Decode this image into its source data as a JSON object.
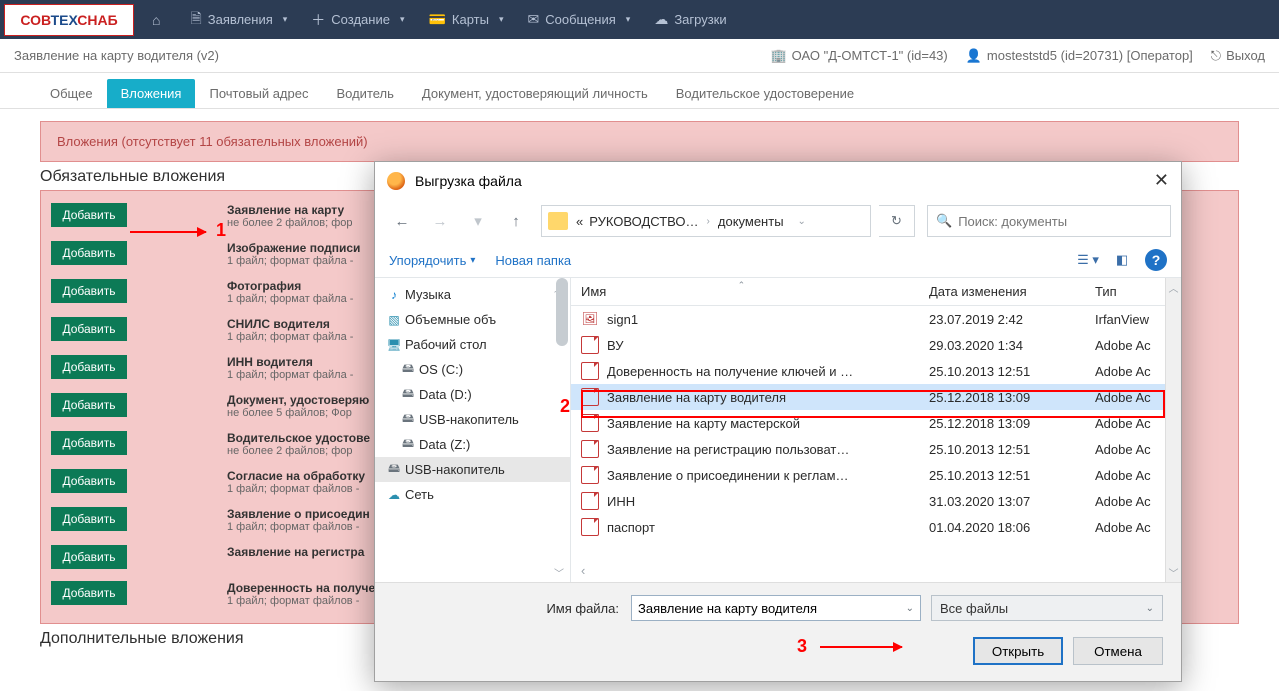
{
  "topnav": {
    "logo_html": "СОВТЕХСНАБ",
    "items": [
      {
        "icon": "⌂",
        "label": ""
      },
      {
        "icon": "📄",
        "label": "Заявления"
      },
      {
        "icon": "+",
        "label": "Создание"
      },
      {
        "icon": "💳",
        "label": "Карты"
      },
      {
        "icon": "✉",
        "label": "Сообщения"
      },
      {
        "icon": "☁",
        "label": "Загрузки"
      }
    ]
  },
  "subheader": {
    "title": "Заявление на карту водителя (v2)",
    "org": "ОАО \"Д-ОМТСТ-1\" (id=43)",
    "user": "mosteststd5 (id=20731) [Оператор]",
    "exit": "Выход"
  },
  "tabs": [
    "Общее",
    "Вложения",
    "Почтовый адрес",
    "Водитель",
    "Документ, удостоверяющий личность",
    "Водительское удостоверение"
  ],
  "active_tab": 1,
  "alert": "Вложения (отсутствует 11 обязательных вложений)",
  "section_req": "Обязательные вложения",
  "section_opt": "Дополнительные вложения",
  "add_label": "Добавить",
  "attachments": [
    {
      "t": "Заявление на карту",
      "s": "не более 2 файлов; фор"
    },
    {
      "t": "Изображение подписи",
      "s": "1 файл; формат файла -"
    },
    {
      "t": "Фотография",
      "s": "1 файл; формат файла -"
    },
    {
      "t": "СНИЛС водителя",
      "s": "1 файл; формат файла -"
    },
    {
      "t": "ИНН водителя",
      "s": "1 файл; формат файла -"
    },
    {
      "t": "Документ, удостоверяю",
      "s": "не более 5 файлов; Фор"
    },
    {
      "t": "Водительское удостове",
      "s": "не более 2 файлов; фор"
    },
    {
      "t": "Согласие на обработку",
      "s": "1 файл; формат файлов -"
    },
    {
      "t": "Заявление о присоедин",
      "s": "1 файл; формат файлов -"
    },
    {
      "t": "Заявление на регистра",
      "s": ""
    },
    {
      "t": "Доверенность на получе",
      "s": "1 файл; формат файлов -"
    }
  ],
  "dialog": {
    "title": "Выгрузка файла",
    "crumb1": "РУКОВОДСТВО…",
    "crumb2": "документы",
    "search_ph": "Поиск: документы",
    "organize": "Упорядочить",
    "new_folder": "Новая папка",
    "tree": [
      {
        "ico": "♪",
        "label": "Музыка",
        "color": "#0e7fd0"
      },
      {
        "ico": "▧",
        "label": "Объемные объ",
        "color": "#2b8faf"
      },
      {
        "ico": "🖥",
        "label": "Рабочий стол",
        "color": "#2b8faf"
      },
      {
        "ico": "🖴",
        "label": "OS (C:)",
        "color": "#6a747d",
        "indent": true
      },
      {
        "ico": "🖴",
        "label": "Data (D:)",
        "color": "#6a747d",
        "indent": true
      },
      {
        "ico": "🖴",
        "label": "USB-накопитель",
        "color": "#6a747d",
        "indent": true
      },
      {
        "ico": "🖴",
        "label": "Data (Z:)",
        "color": "#6a747d",
        "indent": true
      },
      {
        "ico": "🖴",
        "label": "USB-накопитель",
        "color": "#6a747d",
        "sel": true
      },
      {
        "ico": "☁",
        "label": "Сеть",
        "color": "#2b8faf"
      }
    ],
    "cols": {
      "name": "Имя",
      "date": "Дата изменения",
      "type": "Тип"
    },
    "files": [
      {
        "ico": "img",
        "name": "sign1",
        "date": "23.07.2019 2:42",
        "type": "IrfanView"
      },
      {
        "ico": "pdf",
        "name": "ВУ",
        "date": "29.03.2020 1:34",
        "type": "Adobe Ac"
      },
      {
        "ico": "pdf",
        "name": "Доверенность на получение ключей и …",
        "date": "25.10.2013 12:51",
        "type": "Adobe Ac"
      },
      {
        "ico": "pdf",
        "name": "Заявление на карту водителя",
        "date": "25.12.2018 13:09",
        "type": "Adobe Ac",
        "sel": true
      },
      {
        "ico": "pdf",
        "name": "Заявление на карту мастерской",
        "date": "25.12.2018 13:09",
        "type": "Adobe Ac"
      },
      {
        "ico": "pdf",
        "name": "Заявление на регистрацию пользоват…",
        "date": "25.10.2013 12:51",
        "type": "Adobe Ac"
      },
      {
        "ico": "pdf",
        "name": "Заявление о присоединении к реглам…",
        "date": "25.10.2013 12:51",
        "type": "Adobe Ac"
      },
      {
        "ico": "pdf",
        "name": "ИНН",
        "date": "31.03.2020 13:07",
        "type": "Adobe Ac"
      },
      {
        "ico": "pdf",
        "name": "паспорт",
        "date": "01.04.2020 18:06",
        "type": "Adobe Ac"
      }
    ],
    "fname_label": "Имя файла:",
    "fname_value": "Заявление на карту водителя",
    "filter": "Все файлы",
    "open": "Открыть",
    "cancel": "Отмена"
  },
  "annotations": {
    "n1": "1",
    "n2": "2",
    "n3": "3"
  }
}
